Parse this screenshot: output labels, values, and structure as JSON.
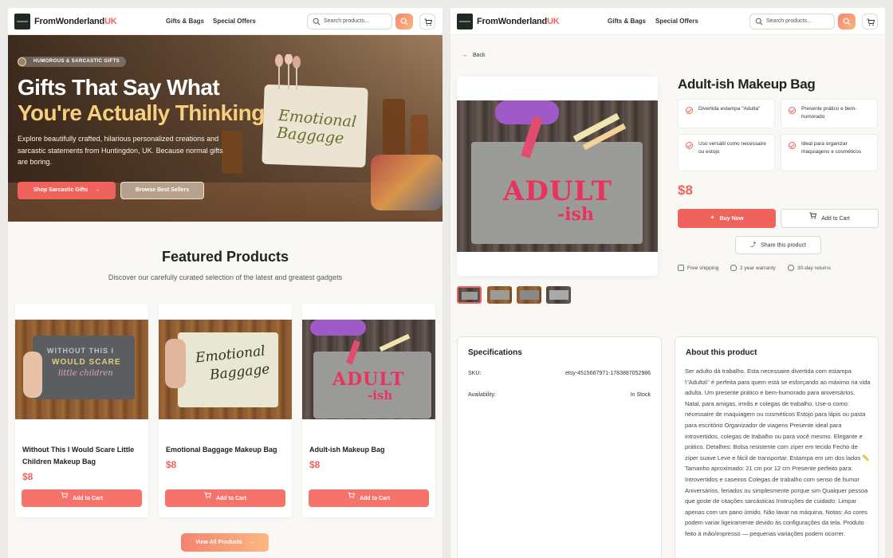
{
  "header": {
    "brand_part1": "FromWonderland",
    "brand_part2": "UK",
    "nav": [
      "Gifts & Bags",
      "Special Offers"
    ],
    "search_placeholder": "Search products..."
  },
  "hero": {
    "badge": "HUMOROUS & SARCASTIC GIFTS",
    "title_line1": "Gifts That Say What",
    "title_line2": "You're Actually Thinking",
    "description": "Explore beautifully crafted, hilarious personalized creations and sarcastic statements from Huntingdon, UK. Because normal gifts are boring.",
    "primary_cta": "Shop Sarcastic Gifts",
    "secondary_cta": "Browse Best Sellers",
    "bag_text_line1": "Emotional",
    "bag_text_line2": "Baggage"
  },
  "featured": {
    "title": "Featured Products",
    "subtitle": "Discover our carefully curated selection of the latest and greatest gadgets",
    "products": [
      {
        "name": "Without This I Would Scare Little Children Makeup Bag",
        "price": "$8",
        "cta": "Add to Cart",
        "art_line1": "WITHOUT THIS I",
        "art_line2": "WOULD SCARE",
        "art_line3": "little children"
      },
      {
        "name": "Emotional Baggage Makeup Bag",
        "price": "$8",
        "cta": "Add to Cart",
        "art_line1": "Emotional",
        "art_line2": "Baggage"
      },
      {
        "name": "Adult-ish Makeup Bag",
        "price": "$8",
        "cta": "Add to Cart",
        "art_line1": "ADULT",
        "art_line2": "-ish"
      }
    ],
    "view_all": "View All Products"
  },
  "product": {
    "back": "Back",
    "title": "Adult-ish Makeup Bag",
    "art_line1": "ADULT",
    "art_line2": "-ish",
    "features": [
      "Divertida estampa \"Adulta\"",
      "Presente prático e bem-humorado",
      "Uso versátil como necessaire ou estojo",
      "Ideal para organizar maquiagens e cosméticos"
    ],
    "price": "$8",
    "buy_now": "Buy Now",
    "add_to_cart": "Add to Cart",
    "share": "Share this product",
    "perks": [
      "Free shipping",
      "2 year warranty",
      "30-day returns"
    ],
    "thumbnail_count": 4
  },
  "specifications": {
    "title": "Specifications",
    "rows": [
      {
        "key": "SKU:",
        "value": "etsy-4515667971-1783887052986"
      },
      {
        "key": "Availability:",
        "value": "In Stock"
      }
    ]
  },
  "about": {
    "title": "About this product",
    "text": "Ser adulto dá trabalho. Esta necessaire divertida com estampa \\\"Adulta\\\" é perfeita para quem está se esforçando ao máximo na vida adulta. Um presente prático e bem-humorado para aniversários, Natal, para amigas, irmãs e colegas de trabalho. Use-o como: nécessaire de maquiagem ou cosméticos Estojo para lápis ou pasta para escritório Organizador de viagens Presente ideal para introvertidos, colegas de trabalho ou para você mesmo. Elegante e prático. Detalhes: Bolsa resistente com zíper em tecido Fecho de zíper suave Leve e fácil de transportar. Estampa em um dos lados 📏 Tamanho aproximado: 21 cm por 12 cm Presente perfeito para: Introvertidos e caseiros Colegas de trabalho com senso de humor Aniversários, feriados ou simplesmente porque sim Qualquer pessoa que goste de citações sarcásticas Instruções de cuidado: Limpar apenas com um pano úmido. Não lavar na máquina. Notas: As cores podem variar ligeiramente devido às configurações da tela. Produto feito à mão/impresso — pequenas variações podem ocorrer."
  },
  "colors": {
    "accent": "#f0625c",
    "gold": "#f7cf7e",
    "background": "#faf8f5"
  }
}
